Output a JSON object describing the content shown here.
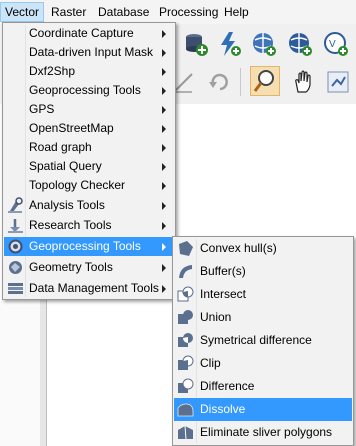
{
  "menubar": {
    "items": [
      "Vector",
      "Raster",
      "Database",
      "Processing",
      "Help"
    ]
  },
  "vector_menu": {
    "items": [
      {
        "label": "Coordinate Capture",
        "submenu": true
      },
      {
        "label": "Data-driven Input Mask",
        "submenu": true
      },
      {
        "label": "Dxf2Shp",
        "submenu": true
      },
      {
        "label": "Geoprocessing Tools",
        "submenu": true
      },
      {
        "label": "GPS",
        "submenu": true
      },
      {
        "label": "OpenStreetMap",
        "submenu": true
      },
      {
        "label": "Road graph",
        "submenu": true
      },
      {
        "label": "Spatial Query",
        "submenu": true
      },
      {
        "label": "Topology Checker",
        "submenu": true
      },
      {
        "label": "Analysis Tools",
        "submenu": true,
        "icon": "analysis-tools-icon"
      },
      {
        "label": "Research Tools",
        "submenu": true,
        "icon": "research-tools-icon"
      },
      {
        "label": "Geoprocessing Tools",
        "submenu": true,
        "icon": "geoprocessing-tools-icon",
        "highlighted": true
      },
      {
        "label": "Geometry Tools",
        "submenu": true,
        "icon": "geometry-tools-icon"
      },
      {
        "label": "Data Management Tools",
        "submenu": true,
        "icon": "data-management-tools-icon"
      }
    ]
  },
  "geoprocessing_submenu": {
    "items": [
      {
        "label": "Convex hull(s)",
        "icon": "convex-hull-icon"
      },
      {
        "label": "Buffer(s)",
        "icon": "buffer-icon"
      },
      {
        "label": "Intersect",
        "icon": "intersect-icon"
      },
      {
        "label": "Union",
        "icon": "union-icon"
      },
      {
        "label": "Symetrical difference",
        "icon": "symmetrical-difference-icon"
      },
      {
        "label": "Clip",
        "icon": "clip-icon"
      },
      {
        "label": "Difference",
        "icon": "difference-icon"
      },
      {
        "label": "Dissolve",
        "icon": "dissolve-icon",
        "highlighted": true
      },
      {
        "label": "Eliminate sliver polygons",
        "icon": "eliminate-sliver-polygons-icon"
      }
    ]
  },
  "colors": {
    "highlight": "#3399ff",
    "menu_bg": "#f2f2f2",
    "menubar_active": "#cce4f7"
  }
}
